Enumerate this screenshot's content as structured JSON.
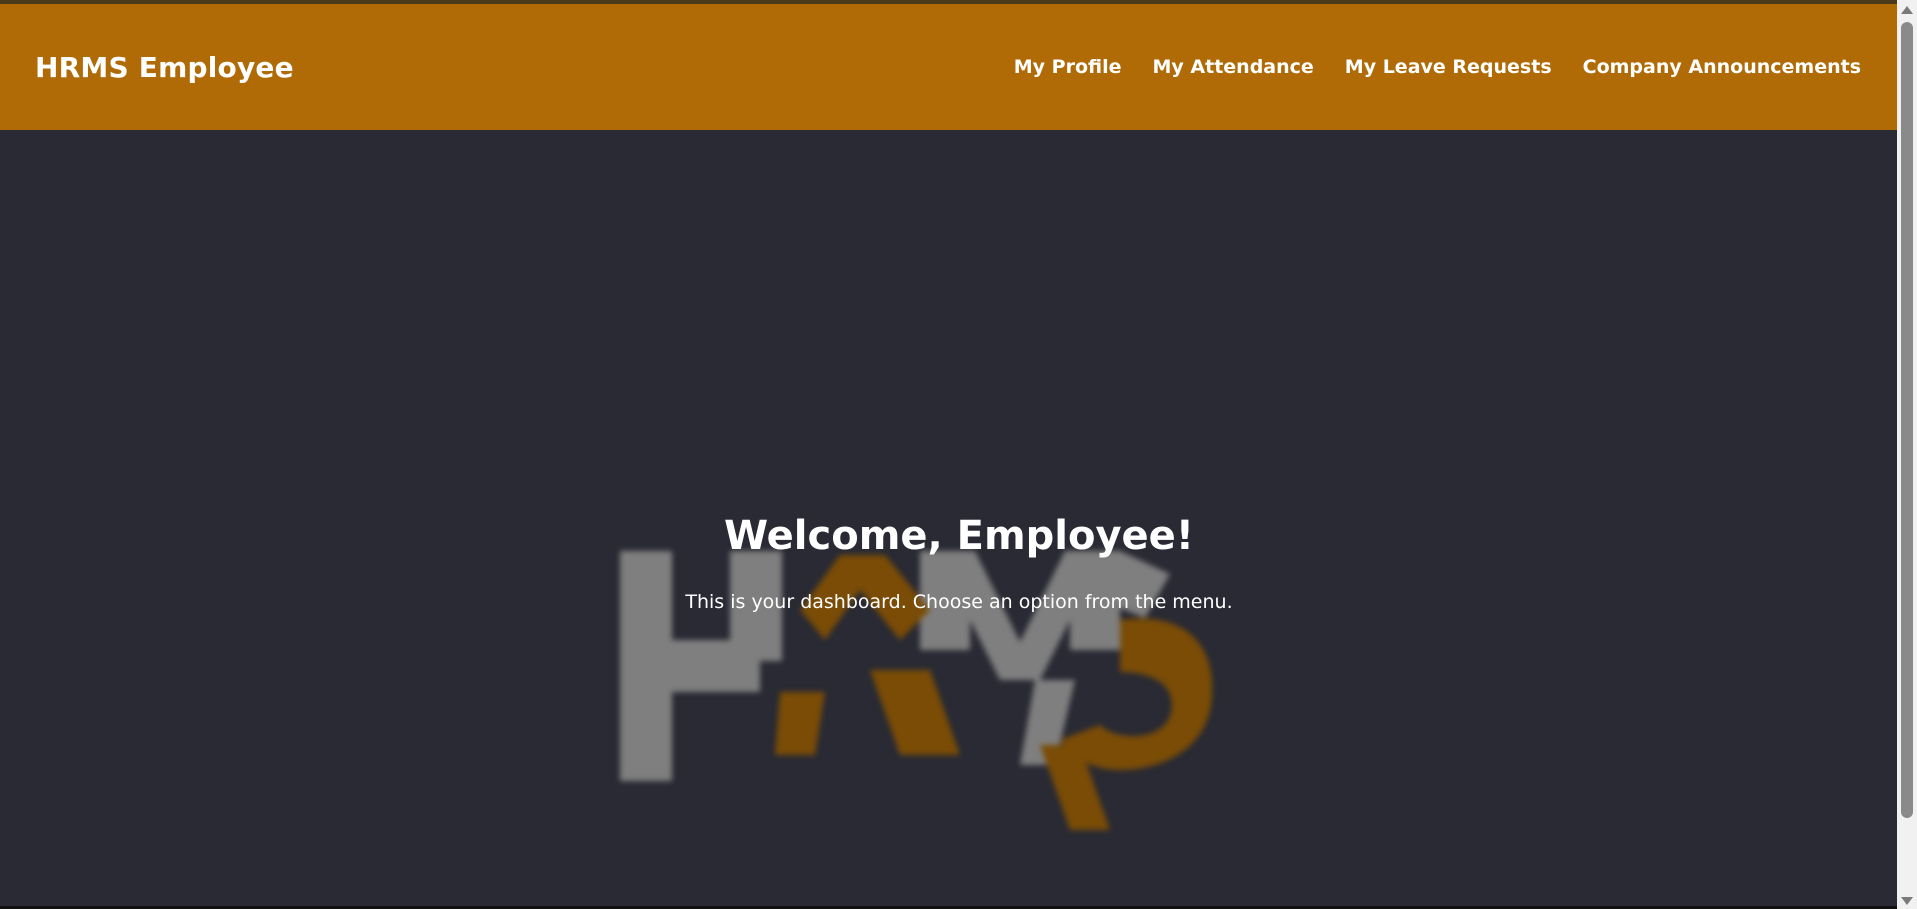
{
  "navbar": {
    "brand": "HRMS Employee",
    "links": [
      {
        "label": "My Profile"
      },
      {
        "label": "My Attendance"
      },
      {
        "label": "My Leave Requests"
      },
      {
        "label": "Company Announcements"
      }
    ],
    "color": "#b06b06"
  },
  "hero": {
    "title": "Welcome, Employee!",
    "subtitle": "This is your dashboard. Choose an option from the menu.",
    "background": "#292a34",
    "watermark_logo": "HRMS"
  },
  "colors": {
    "accent": "#b06b06",
    "logo_gray": "#7f7f7f",
    "logo_orange": "#7a4c06"
  }
}
